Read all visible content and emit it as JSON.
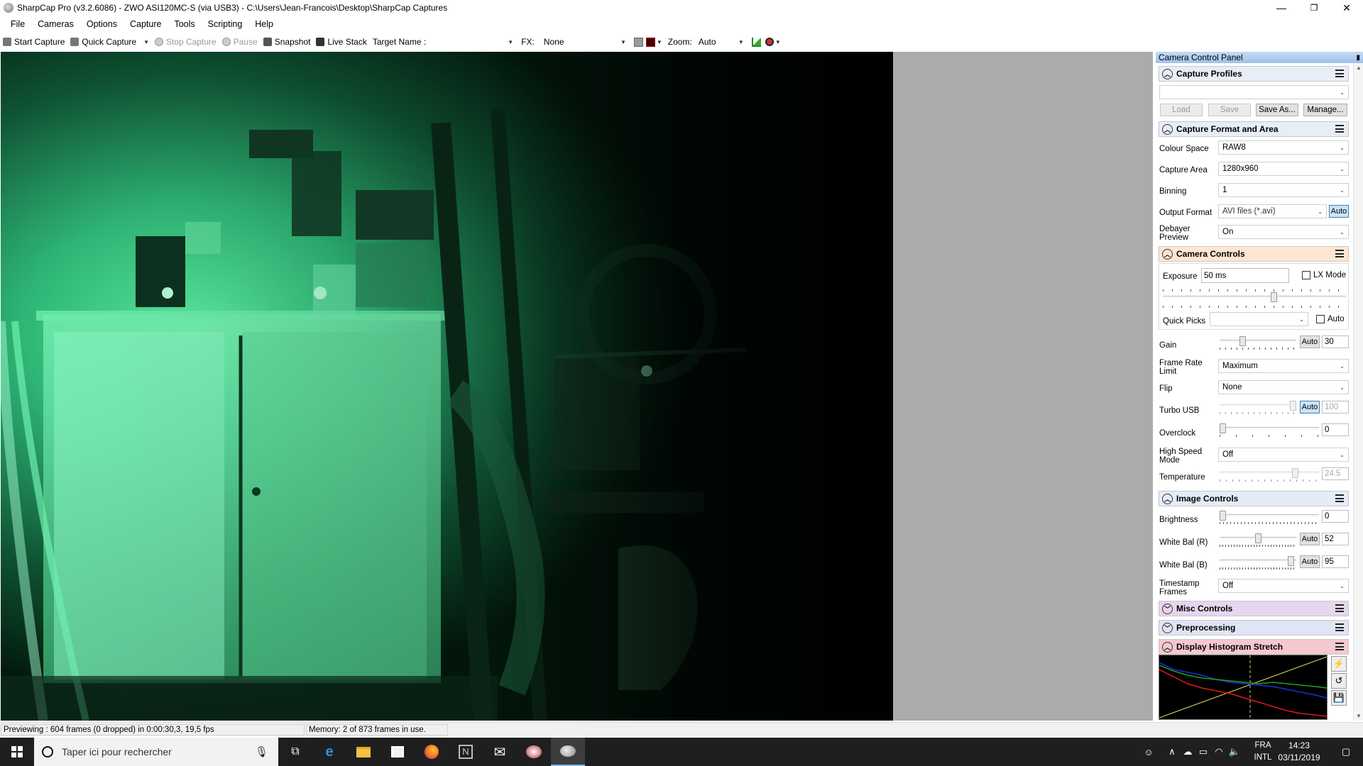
{
  "window": {
    "title": "SharpCap Pro (v3.2.6086) - ZWO ASI120MC-S (via USB3) - C:\\Users\\Jean-Francois\\Desktop\\SharpCap Captures",
    "minimize": "—",
    "maximize": "❐",
    "close": "✕"
  },
  "menu": [
    "File",
    "Cameras",
    "Options",
    "Capture",
    "Tools",
    "Scripting",
    "Help"
  ],
  "toolbar": {
    "start_capture": "Start Capture",
    "quick_capture": "Quick Capture",
    "stop_capture": "Stop Capture",
    "pause": "Pause",
    "snapshot": "Snapshot",
    "live_stack": "Live Stack",
    "target_name_label": "Target Name :",
    "target_name_value": "",
    "fx_label": "FX:",
    "fx_value": "None",
    "zoom_label": "Zoom:",
    "zoom_value": "Auto"
  },
  "panel": {
    "title": "Camera Control Panel",
    "pin_icon": "pin-icon",
    "capture_profiles": {
      "header": "Capture Profiles",
      "selected": "",
      "load": "Load",
      "save": "Save",
      "save_as": "Save As...",
      "manage": "Manage..."
    },
    "capture_format": {
      "header": "Capture Format and Area",
      "colour_space_label": "Colour Space",
      "colour_space": "RAW8",
      "capture_area_label": "Capture Area",
      "capture_area": "1280x960",
      "binning_label": "Binning",
      "binning": "1",
      "output_format_label": "Output Format",
      "output_format": "AVI files (*.avi)",
      "output_auto": "Auto",
      "debayer_label_1": "Debayer",
      "debayer_label_2": "Preview",
      "debayer": "On"
    },
    "camera_controls": {
      "header": "Camera Controls",
      "exposure_label": "Exposure",
      "exposure": "50 ms",
      "lx_mode": "LX Mode",
      "quick_picks_label": "Quick Picks",
      "quick_picks": "",
      "quick_auto": "Auto",
      "gain_label": "Gain",
      "gain_auto": "Auto",
      "gain": "30",
      "frame_rate_label_1": "Frame Rate",
      "frame_rate_label_2": "Limit",
      "frame_rate": "Maximum",
      "flip_label": "Flip",
      "flip": "None",
      "turbo_label": "Turbo USB",
      "turbo_auto": "Auto",
      "turbo": "100",
      "overclock_label": "Overclock",
      "overclock": "0",
      "high_speed_label_1": "High Speed",
      "high_speed_label_2": "Mode",
      "high_speed": "Off",
      "temperature_label": "Temperature",
      "temperature": "24.5"
    },
    "image_controls": {
      "header": "Image Controls",
      "brightness_label": "Brightness",
      "brightness": "0",
      "wb_r_label": "White Bal (R)",
      "wb_r_auto": "Auto",
      "wb_r": "52",
      "wb_b_label": "White Bal (B)",
      "wb_b_auto": "Auto",
      "wb_b": "95",
      "timestamp_label_1": "Timestamp",
      "timestamp_label_2": "Frames",
      "timestamp": "Off"
    },
    "misc_controls": {
      "header": "Misc Controls"
    },
    "preprocessing": {
      "header": "Preprocessing"
    },
    "histogram": {
      "header": "Display Histogram Stretch"
    },
    "colors": {
      "capture_profiles_bg": "#e8eef8",
      "capture_format_bg": "#e8eef8",
      "camera_controls_bg": "#fde6d2",
      "image_controls_bg": "#e4ecf8",
      "misc_controls_bg": "#e8d5ee",
      "preprocessing_bg": "#e0e4f4",
      "histogram_bg": "#f6c8cf"
    }
  },
  "status": {
    "preview": "Previewing : 604 frames (0 dropped) in 0:00:30,3, 19,5 fps",
    "memory": "Memory: 2 of 873 frames in use."
  },
  "taskbar": {
    "search_placeholder": "Taper ici pour rechercher",
    "lang_1": "FRA",
    "lang_2": "INTL",
    "time": "14:23",
    "date": "03/11/2019"
  }
}
